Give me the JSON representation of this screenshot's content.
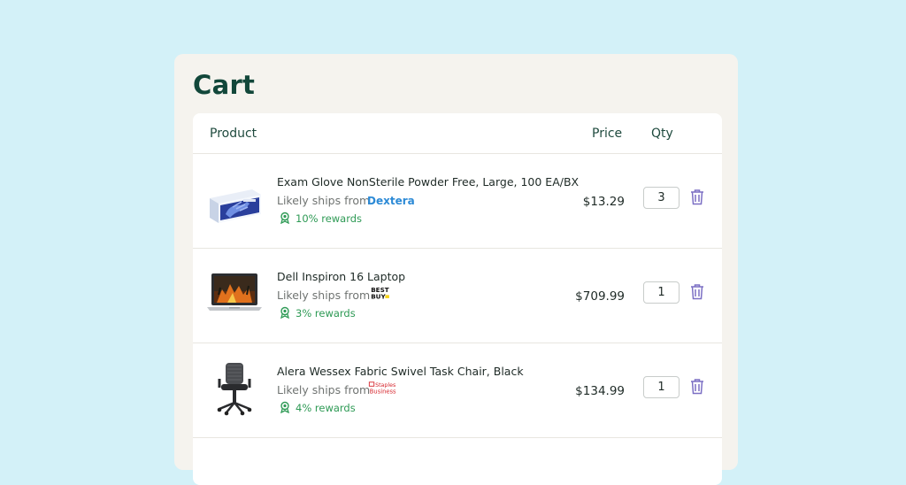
{
  "cart": {
    "title": "Cart",
    "columns": {
      "product": "Product",
      "price": "Price",
      "qty": "Qty"
    },
    "items": [
      {
        "name": "Exam Glove NonSterile Powder Free, Large, 100 EA/BX",
        "ships_label": "Likely ships from",
        "retailer": "Dextera",
        "rewards": "10% rewards",
        "price": "$13.29",
        "qty": "3"
      },
      {
        "name": "Dell Inspiron 16 Laptop",
        "ships_label": "Likely ships from",
        "retailer": "Best Buy",
        "retailer_logo_text": [
          "BEST",
          "BUY"
        ],
        "rewards": "3% rewards",
        "price": "$709.99",
        "qty": "1"
      },
      {
        "name": "Alera Wessex Fabric Swivel Task Chair, Black",
        "ships_label": "Likely ships from",
        "retailer": "Staples Business",
        "retailer_logo_text": [
          "Staples",
          "Business"
        ],
        "rewards": "4% rewards",
        "price": "$134.99",
        "qty": "1"
      }
    ]
  },
  "icons": {
    "rewards": "rewards-badge-icon",
    "delete": "trash-icon"
  },
  "colors": {
    "background": "#d3f1f8",
    "title": "#12473a",
    "rewards": "#2e9a55",
    "trash": "#7b6fc4",
    "dextera": "#2c8ad6",
    "staples": "#d6262d"
  }
}
